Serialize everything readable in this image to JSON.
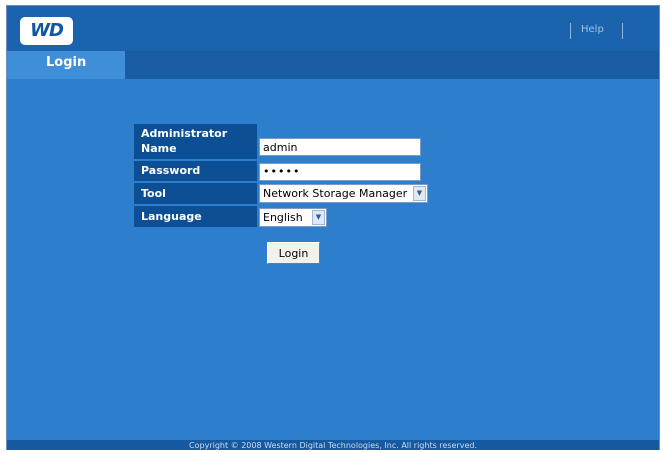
{
  "header": {
    "logo_text": "WD",
    "help_label": "Help"
  },
  "tabs": {
    "login_label": "Login"
  },
  "form": {
    "admin_name_label_line1": "Administrator",
    "admin_name_label_line2": "Name",
    "admin_name_value": "admin",
    "password_label": "Password",
    "password_value": "•••••",
    "tool_label": "Tool",
    "tool_selected": "Network Storage Manager",
    "language_label": "Language",
    "language_selected": "English",
    "login_button_label": "Login"
  },
  "footer": {
    "copyright": "Copyright © 2008 Western Digital Technologies, Inc. All rights reserved."
  },
  "colors": {
    "background": "#2d7fcd",
    "header": "#1c63ae",
    "label_cell": "#0d4f94",
    "active_tab": "#3f8fd8"
  },
  "icons": {
    "dropdown_arrow": "chevron-down-icon"
  }
}
